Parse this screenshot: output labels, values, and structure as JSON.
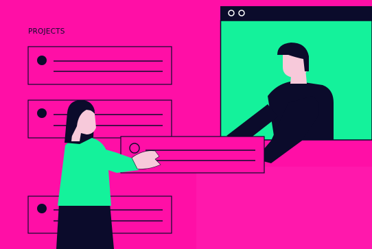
{
  "header": {
    "section_title": "PROJECTS"
  },
  "colors": {
    "background": "#ff0fa6",
    "accent_green": "#14f29b",
    "ink": "#0b0b2b",
    "skin": "#f7c9da"
  },
  "icons": {
    "window_controls": "two-circle-window-buttons",
    "list_bullet": "filled-circle-bullet",
    "dragged_bullet": "outline-circle-bullet"
  }
}
